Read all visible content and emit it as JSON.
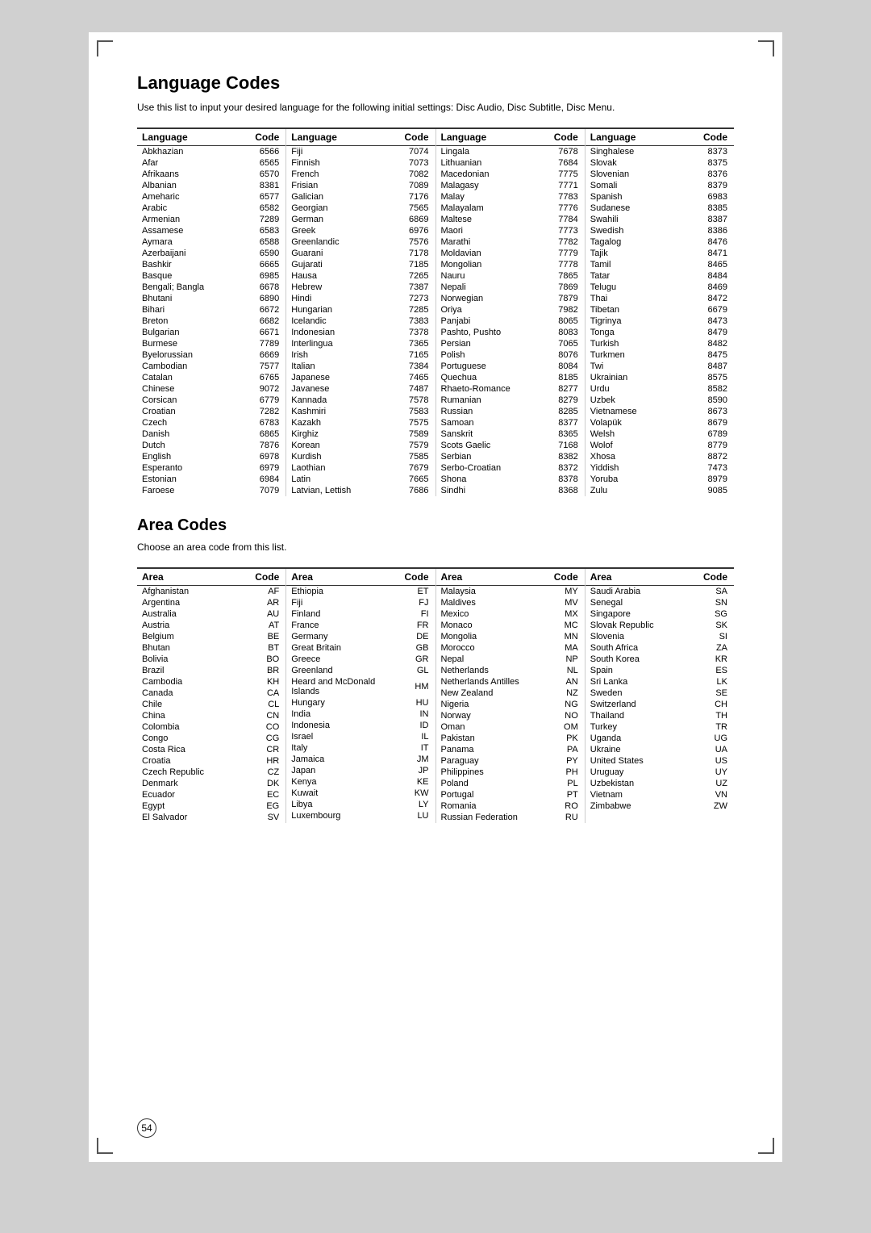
{
  "page": {
    "title": "Language Codes",
    "description": "Use this list to input your desired language for the following initial settings:\nDisc Audio, Disc Subtitle, Disc Menu.",
    "area_title": "Area Codes",
    "area_description": "Choose an area code from this list.",
    "page_number": "54"
  },
  "language_columns": [
    {
      "header_lang": "Language",
      "header_code": "Code",
      "rows": [
        [
          "Abkhazian",
          "6566"
        ],
        [
          "Afar",
          "6565"
        ],
        [
          "Afrikaans",
          "6570"
        ],
        [
          "Albanian",
          "8381"
        ],
        [
          "Ameharic",
          "6577"
        ],
        [
          "Arabic",
          "6582"
        ],
        [
          "Armenian",
          "7289"
        ],
        [
          "Assamese",
          "6583"
        ],
        [
          "Aymara",
          "6588"
        ],
        [
          "Azerbaijani",
          "6590"
        ],
        [
          "Bashkir",
          "6665"
        ],
        [
          "Basque",
          "6985"
        ],
        [
          "Bengali; Bangla",
          "6678"
        ],
        [
          "Bhutani",
          "6890"
        ],
        [
          "Bihari",
          "6672"
        ],
        [
          "Breton",
          "6682"
        ],
        [
          "Bulgarian",
          "6671"
        ],
        [
          "Burmese",
          "7789"
        ],
        [
          "Byelorussian",
          "6669"
        ],
        [
          "Cambodian",
          "7577"
        ],
        [
          "Catalan",
          "6765"
        ],
        [
          "Chinese",
          "9072"
        ],
        [
          "Corsican",
          "6779"
        ],
        [
          "Croatian",
          "7282"
        ],
        [
          "Czech",
          "6783"
        ],
        [
          "Danish",
          "6865"
        ],
        [
          "Dutch",
          "7876"
        ],
        [
          "English",
          "6978"
        ],
        [
          "Esperanto",
          "6979"
        ],
        [
          "Estonian",
          "6984"
        ],
        [
          "Faroese",
          "7079"
        ]
      ]
    },
    {
      "header_lang": "Language",
      "header_code": "Code",
      "rows": [
        [
          "Fiji",
          "7074"
        ],
        [
          "Finnish",
          "7073"
        ],
        [
          "French",
          "7082"
        ],
        [
          "Frisian",
          "7089"
        ],
        [
          "Galician",
          "7176"
        ],
        [
          "Georgian",
          "7565"
        ],
        [
          "German",
          "6869"
        ],
        [
          "Greek",
          "6976"
        ],
        [
          "Greenlandic",
          "7576"
        ],
        [
          "Guarani",
          "7178"
        ],
        [
          "Gujarati",
          "7185"
        ],
        [
          "Hausa",
          "7265"
        ],
        [
          "Hebrew",
          "7387"
        ],
        [
          "Hindi",
          "7273"
        ],
        [
          "Hungarian",
          "7285"
        ],
        [
          "Icelandic",
          "7383"
        ],
        [
          "Indonesian",
          "7378"
        ],
        [
          "Interlingua",
          "7365"
        ],
        [
          "Irish",
          "7165"
        ],
        [
          "Italian",
          "7384"
        ],
        [
          "Japanese",
          "7465"
        ],
        [
          "Javanese",
          "7487"
        ],
        [
          "Kannada",
          "7578"
        ],
        [
          "Kashmiri",
          "7583"
        ],
        [
          "Kazakh",
          "7575"
        ],
        [
          "Kirghiz",
          "7589"
        ],
        [
          "Korean",
          "7579"
        ],
        [
          "Kurdish",
          "7585"
        ],
        [
          "Laothian",
          "7679"
        ],
        [
          "Latin",
          "7665"
        ],
        [
          "Latvian, Lettish",
          "7686"
        ]
      ]
    },
    {
      "header_lang": "Language",
      "header_code": "Code",
      "rows": [
        [
          "Lingala",
          "7678"
        ],
        [
          "Lithuanian",
          "7684"
        ],
        [
          "Macedonian",
          "7775"
        ],
        [
          "Malagasy",
          "7771"
        ],
        [
          "Malay",
          "7783"
        ],
        [
          "Malayalam",
          "7776"
        ],
        [
          "Maltese",
          "7784"
        ],
        [
          "Maori",
          "7773"
        ],
        [
          "Marathi",
          "7782"
        ],
        [
          "Moldavian",
          "7779"
        ],
        [
          "Mongolian",
          "7778"
        ],
        [
          "Nauru",
          "7865"
        ],
        [
          "Nepali",
          "7869"
        ],
        [
          "Norwegian",
          "7879"
        ],
        [
          "Oriya",
          "7982"
        ],
        [
          "Panjabi",
          "8065"
        ],
        [
          "Pashto, Pushto",
          "8083"
        ],
        [
          "Persian",
          "7065"
        ],
        [
          "Polish",
          "8076"
        ],
        [
          "Portuguese",
          "8084"
        ],
        [
          "Quechua",
          "8185"
        ],
        [
          "Rhaeto-Romance",
          "8277"
        ],
        [
          "Rumanian",
          "8279"
        ],
        [
          "Russian",
          "8285"
        ],
        [
          "Samoan",
          "8377"
        ],
        [
          "Sanskrit",
          "8365"
        ],
        [
          "Scots Gaelic",
          "7168"
        ],
        [
          "Serbian",
          "8382"
        ],
        [
          "Serbo-Croatian",
          "8372"
        ],
        [
          "Shona",
          "8378"
        ],
        [
          "Sindhi",
          "8368"
        ]
      ]
    },
    {
      "header_lang": "Language",
      "header_code": "Code",
      "rows": [
        [
          "Singhalese",
          "8373"
        ],
        [
          "Slovak",
          "8375"
        ],
        [
          "Slovenian",
          "8376"
        ],
        [
          "Somali",
          "8379"
        ],
        [
          "Spanish",
          "6983"
        ],
        [
          "Sudanese",
          "8385"
        ],
        [
          "Swahili",
          "8387"
        ],
        [
          "Swedish",
          "8386"
        ],
        [
          "Tagalog",
          "8476"
        ],
        [
          "Tajik",
          "8471"
        ],
        [
          "Tamil",
          "8465"
        ],
        [
          "Tatar",
          "8484"
        ],
        [
          "Telugu",
          "8469"
        ],
        [
          "Thai",
          "8472"
        ],
        [
          "Tibetan",
          "6679"
        ],
        [
          "Tigrinya",
          "8473"
        ],
        [
          "Tonga",
          "8479"
        ],
        [
          "Turkish",
          "8482"
        ],
        [
          "Turkmen",
          "8475"
        ],
        [
          "Twi",
          "8487"
        ],
        [
          "Ukrainian",
          "8575"
        ],
        [
          "Urdu",
          "8582"
        ],
        [
          "Uzbek",
          "8590"
        ],
        [
          "Vietnamese",
          "8673"
        ],
        [
          "Volapük",
          "8679"
        ],
        [
          "Welsh",
          "6789"
        ],
        [
          "Wolof",
          "8779"
        ],
        [
          "Xhosa",
          "8872"
        ],
        [
          "Yiddish",
          "7473"
        ],
        [
          "Yoruba",
          "8979"
        ],
        [
          "Zulu",
          "9085"
        ]
      ]
    }
  ],
  "area_columns": [
    {
      "header_area": "Area",
      "header_code": "Code",
      "rows": [
        [
          "Afghanistan",
          "AF"
        ],
        [
          "Argentina",
          "AR"
        ],
        [
          "Australia",
          "AU"
        ],
        [
          "Austria",
          "AT"
        ],
        [
          "Belgium",
          "BE"
        ],
        [
          "Bhutan",
          "BT"
        ],
        [
          "Bolivia",
          "BO"
        ],
        [
          "Brazil",
          "BR"
        ],
        [
          "Cambodia",
          "KH"
        ],
        [
          "Canada",
          "CA"
        ],
        [
          "Chile",
          "CL"
        ],
        [
          "China",
          "CN"
        ],
        [
          "Colombia",
          "CO"
        ],
        [
          "Congo",
          "CG"
        ],
        [
          "Costa Rica",
          "CR"
        ],
        [
          "Croatia",
          "HR"
        ],
        [
          "Czech Republic",
          "CZ"
        ],
        [
          "Denmark",
          "DK"
        ],
        [
          "Ecuador",
          "EC"
        ],
        [
          "Egypt",
          "EG"
        ],
        [
          "El Salvador",
          "SV"
        ]
      ]
    },
    {
      "header_area": "Area",
      "header_code": "Code",
      "rows": [
        [
          "Ethiopia",
          "ET"
        ],
        [
          "Fiji",
          "FJ"
        ],
        [
          "Finland",
          "FI"
        ],
        [
          "France",
          "FR"
        ],
        [
          "Germany",
          "DE"
        ],
        [
          "Great Britain",
          "GB"
        ],
        [
          "Greece",
          "GR"
        ],
        [
          "Greenland",
          "GL"
        ],
        [
          "Heard and McDonald Islands",
          "HM"
        ],
        [
          "Hungary",
          "HU"
        ],
        [
          "India",
          "IN"
        ],
        [
          "Indonesia",
          "ID"
        ],
        [
          "Israel",
          "IL"
        ],
        [
          "Italy",
          "IT"
        ],
        [
          "Jamaica",
          "JM"
        ],
        [
          "Japan",
          "JP"
        ],
        [
          "Kenya",
          "KE"
        ],
        [
          "Kuwait",
          "KW"
        ],
        [
          "Libya",
          "LY"
        ],
        [
          "Luxembourg",
          "LU"
        ]
      ]
    },
    {
      "header_area": "Area",
      "header_code": "Code",
      "rows": [
        [
          "Malaysia",
          "MY"
        ],
        [
          "Maldives",
          "MV"
        ],
        [
          "Mexico",
          "MX"
        ],
        [
          "Monaco",
          "MC"
        ],
        [
          "Mongolia",
          "MN"
        ],
        [
          "Morocco",
          "MA"
        ],
        [
          "Nepal",
          "NP"
        ],
        [
          "Netherlands",
          "NL"
        ],
        [
          "Netherlands Antilles",
          "AN"
        ],
        [
          "New Zealand",
          "NZ"
        ],
        [
          "Nigeria",
          "NG"
        ],
        [
          "Norway",
          "NO"
        ],
        [
          "Oman",
          "OM"
        ],
        [
          "Pakistan",
          "PK"
        ],
        [
          "Panama",
          "PA"
        ],
        [
          "Paraguay",
          "PY"
        ],
        [
          "Philippines",
          "PH"
        ],
        [
          "Poland",
          "PL"
        ],
        [
          "Portugal",
          "PT"
        ],
        [
          "Romania",
          "RO"
        ],
        [
          "Russian Federation",
          "RU"
        ]
      ]
    },
    {
      "header_area": "Area",
      "header_code": "Code",
      "rows": [
        [
          "Saudi Arabia",
          "SA"
        ],
        [
          "Senegal",
          "SN"
        ],
        [
          "Singapore",
          "SG"
        ],
        [
          "Slovak Republic",
          "SK"
        ],
        [
          "Slovenia",
          "SI"
        ],
        [
          "South Africa",
          "ZA"
        ],
        [
          "South Korea",
          "KR"
        ],
        [
          "Spain",
          "ES"
        ],
        [
          "Sri Lanka",
          "LK"
        ],
        [
          "Sweden",
          "SE"
        ],
        [
          "Switzerland",
          "CH"
        ],
        [
          "Thailand",
          "TH"
        ],
        [
          "Turkey",
          "TR"
        ],
        [
          "Uganda",
          "UG"
        ],
        [
          "Ukraine",
          "UA"
        ],
        [
          "United States",
          "US"
        ],
        [
          "Uruguay",
          "UY"
        ],
        [
          "Uzbekistan",
          "UZ"
        ],
        [
          "Vietnam",
          "VN"
        ],
        [
          "Zimbabwe",
          "ZW"
        ]
      ]
    }
  ]
}
